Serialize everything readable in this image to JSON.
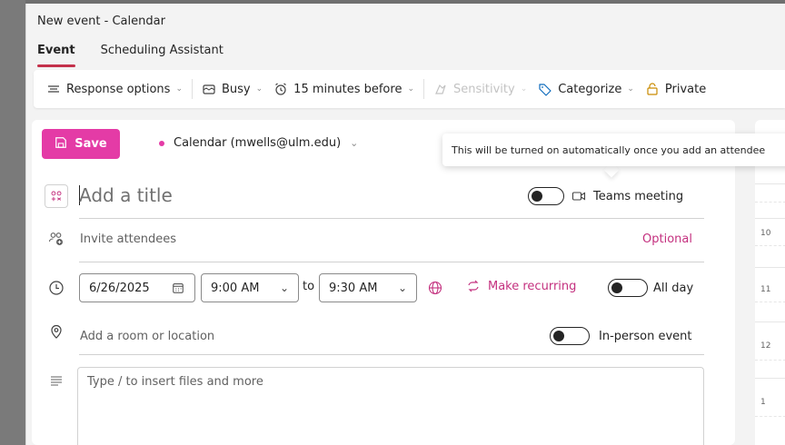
{
  "window": {
    "title": "New event - Calendar"
  },
  "tabs": [
    {
      "label": "Event",
      "active": true
    },
    {
      "label": "Scheduling Assistant",
      "active": false
    }
  ],
  "toolbar": {
    "response_options": "Response options",
    "busy": "Busy",
    "reminder": "15 minutes before",
    "sensitivity": "Sensitivity",
    "categorize": "Categorize",
    "private": "Private"
  },
  "header": {
    "save_label": "Save",
    "calendar": "Calendar (mwells@ulm.edu)"
  },
  "tooltip": {
    "text": "This will be turned on automatically once you add an attendee"
  },
  "form": {
    "title_placeholder": "Add a title",
    "teams_meeting": "Teams meeting",
    "invite_placeholder": "Invite attendees",
    "optional": "Optional",
    "date": "6/26/2025",
    "start_time": "9:00 AM",
    "to_label": "to",
    "end_time": "9:30 AM",
    "make_recurring": "Make recurring",
    "all_day": "All day",
    "location_placeholder": "Add a room or location",
    "in_person": "In-person event",
    "body_placeholder": "Type / to insert files and more"
  },
  "side_calendar": {
    "hours": [
      "10",
      "11",
      "12",
      "1"
    ]
  },
  "colors": {
    "accent": "#e43ba6",
    "tab_underline": "#c4314b",
    "link": "#c4317f"
  }
}
